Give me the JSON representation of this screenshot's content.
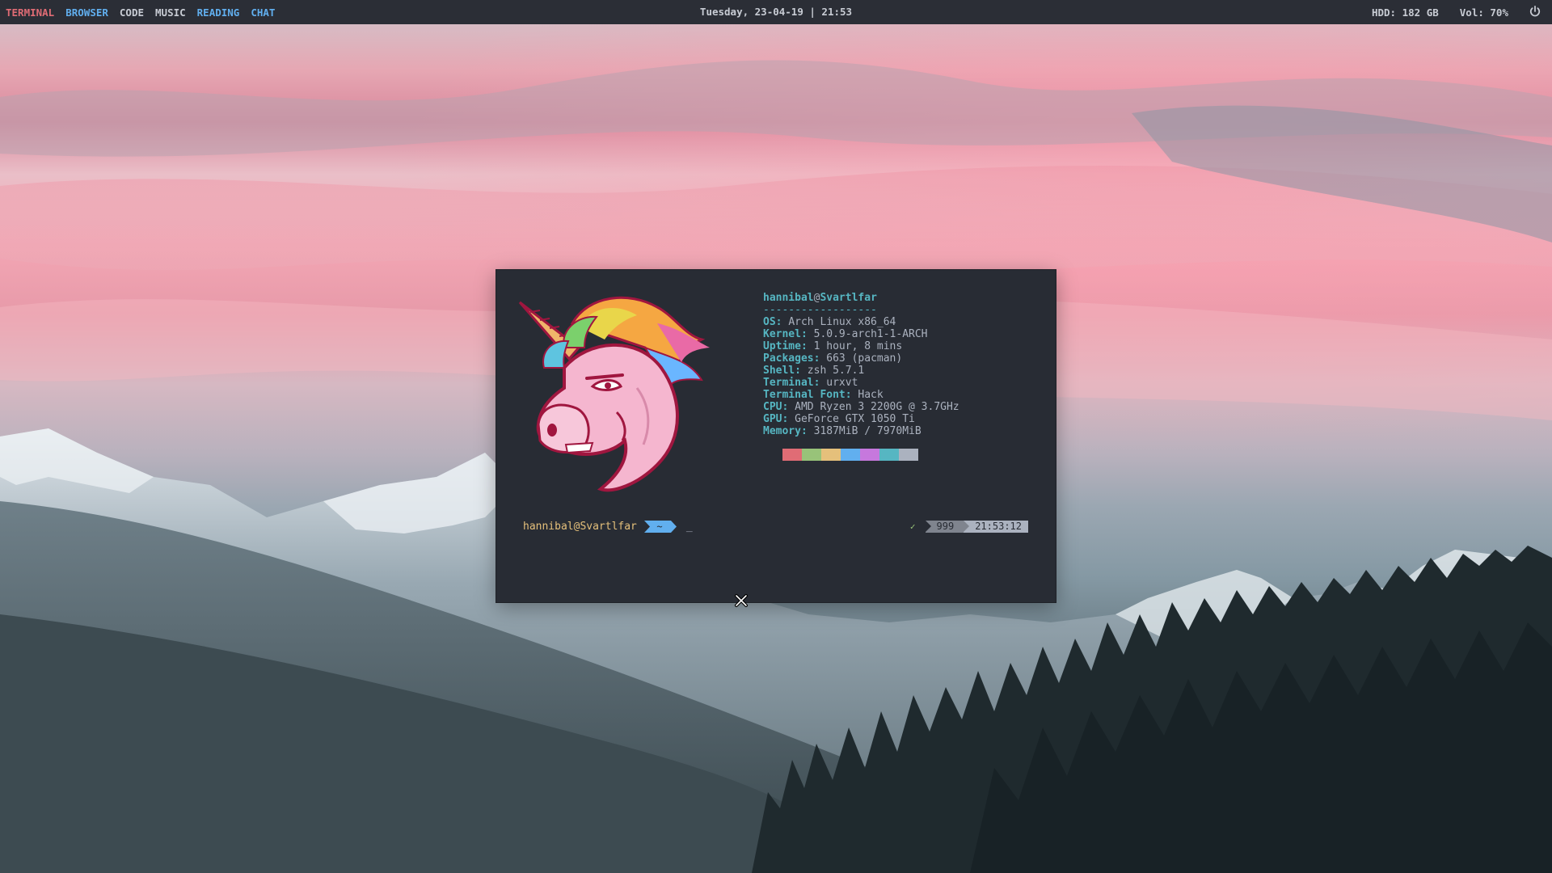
{
  "topbar": {
    "workspaces": [
      "TERMINAL",
      "BROWSER",
      "CODE",
      "MUSIC",
      "READING",
      "CHAT"
    ],
    "clock": "Tuesday, 23-04-19 | 21:53",
    "hdd": "HDD: 182 GB",
    "volume": "Vol: 70%",
    "power_icon": "power-icon"
  },
  "terminal": {
    "info_user": "hannibal",
    "info_at": "@",
    "info_host": "Svartlfar",
    "separator": "------------------",
    "info": [
      {
        "key": "OS",
        "value": "Arch Linux x86_64"
      },
      {
        "key": "Kernel",
        "value": "5.0.9-arch1-1-ARCH"
      },
      {
        "key": "Uptime",
        "value": "1 hour, 8 mins"
      },
      {
        "key": "Packages",
        "value": "663 (pacman)"
      },
      {
        "key": "Shell",
        "value": "zsh 5.7.1"
      },
      {
        "key": "Terminal",
        "value": "urxvt"
      },
      {
        "key": "Terminal Font",
        "value": "Hack"
      },
      {
        "key": "CPU",
        "value": "AMD Ryzen 3 2200G @ 3.7GHz"
      },
      {
        "key": "GPU",
        "value": "GeForce GTX 1050 Ti"
      },
      {
        "key": "Memory",
        "value": "3187MiB / 7970MiB"
      }
    ],
    "palette": [
      "#e06c75",
      "#98c379",
      "#e5c07b",
      "#61afef",
      "#c678dd",
      "#56b6c2",
      "#abb2bf"
    ],
    "prompt_user": "hannibal@Svartlfar",
    "prompt_dir": "~",
    "cursor": "_",
    "rprompt_check": "✓",
    "rprompt_count": "999",
    "rprompt_time": "21:53:12",
    "logo_icon": "unicorn-logo"
  },
  "colors": {
    "topbar_bg": "#2b2e36",
    "terminal_bg": "#282c34",
    "accent_red": "#e06c75",
    "accent_blue": "#61afef",
    "accent_cyan": "#56b6c2",
    "accent_yellow": "#e5c07b"
  }
}
